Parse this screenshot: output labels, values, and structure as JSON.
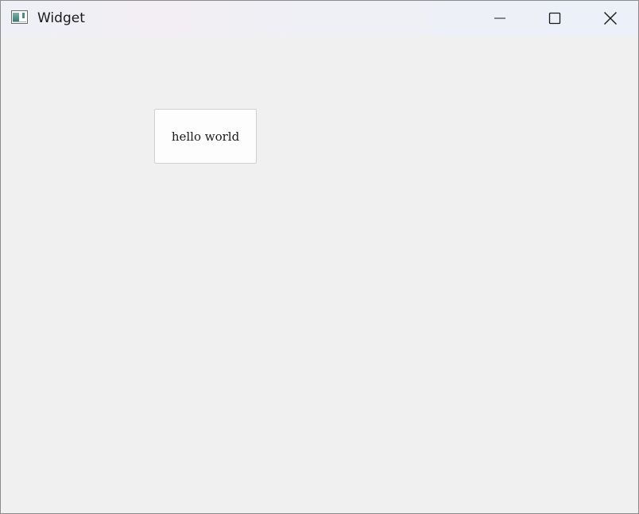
{
  "window": {
    "title": "Widget",
    "icon": "qt-widget-app-icon",
    "controls": {
      "minimize_icon": "minimize-icon",
      "maximize_icon": "maximize-icon",
      "close_icon": "close-icon"
    }
  },
  "content": {
    "button_label": "hello world"
  },
  "colors": {
    "window_background": "#f0f0f0",
    "button_background": "#fdfdfd",
    "button_border": "#d0d0d0",
    "text": "#1a1a1a"
  }
}
